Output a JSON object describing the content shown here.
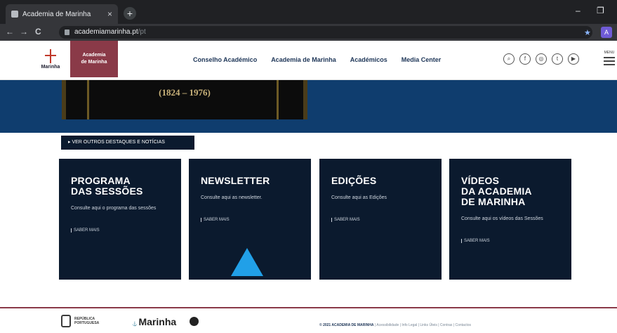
{
  "browser": {
    "tab_title": "Academia de Marinha",
    "tab_close": "×",
    "new_tab": "+",
    "url": "academiamarinha.pt",
    "url_rest": "/pt",
    "minimize": "–",
    "restore": "❐",
    "nav_back": "←",
    "nav_forward": "→",
    "reload": "C",
    "bookmark_star": "★",
    "profile_initial": "A"
  },
  "header": {
    "logo_text": "Marinha",
    "brand_tab": "Academia\nde Marinha",
    "nav": [
      "Conselho Académico",
      "Academia de Marinha",
      "Académicos",
      "Media Center"
    ],
    "social": [
      "search-icon",
      "facebook-icon",
      "instagram-icon",
      "twitter-icon",
      "youtube-icon"
    ],
    "menu_label": "MENU"
  },
  "hero": {
    "book_years": "(1824 – 1976)"
  },
  "see_more": "▸  VER OUTROS DESTAQUES E NOTÍCIAS",
  "cards": [
    {
      "title": "PROGRAMA\nDAS SESSÕES",
      "desc": "Consulte aqui o programa das sessões",
      "more": "SABER MAIS"
    },
    {
      "title": "NEWSLETTER",
      "desc": "Consulte aqui as newsletter.",
      "more": "SABER MAIS"
    },
    {
      "title": "EDIÇÕES",
      "desc": "Consulte aqui as Edições",
      "more": "SABER MAIS"
    },
    {
      "title": "VÍDEOS\nDA ACADEMIA\nDE MARINHA",
      "desc": "Consulte aqui os vídeos das Sessões",
      "more": "SABER MAIS"
    }
  ],
  "footer": {
    "rep_line1": "REPÚBLICA",
    "rep_line2": "PORTUGUESA",
    "marinha": "Marinha",
    "copyright_bold": "© 2021 ACADEMIA DE MARINHA",
    "copyright_rest": " | Acessibilidade | Info Legal | Links Úteis | Contras | Contactos"
  }
}
